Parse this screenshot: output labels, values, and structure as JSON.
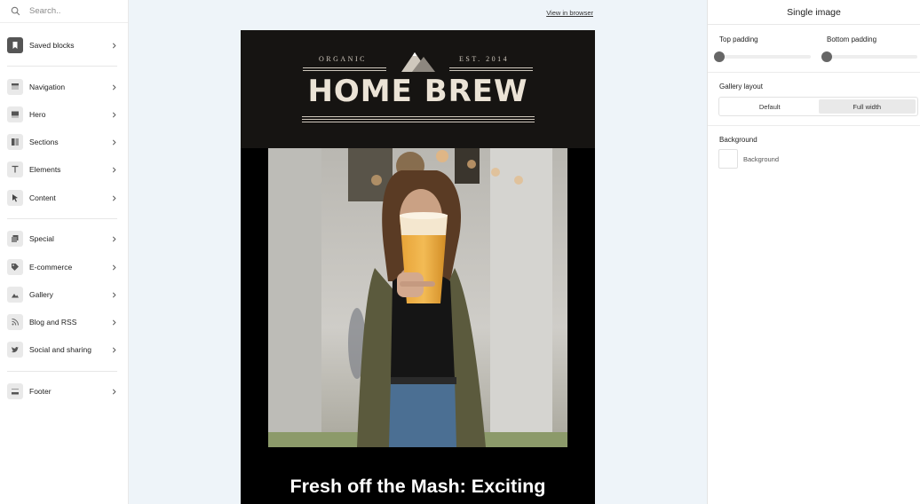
{
  "sidebar": {
    "search_placeholder": "Search..",
    "items": [
      {
        "label": "Saved blocks",
        "icon": "bookmark-icon"
      },
      {
        "label": "Navigation",
        "icon": "navigation-icon"
      },
      {
        "label": "Hero",
        "icon": "hero-icon"
      },
      {
        "label": "Sections",
        "icon": "sections-icon"
      },
      {
        "label": "Elements",
        "icon": "text-icon"
      },
      {
        "label": "Content",
        "icon": "cursor-icon"
      },
      {
        "label": "Special",
        "icon": "special-icon"
      },
      {
        "label": "E-commerce",
        "icon": "tag-icon"
      },
      {
        "label": "Gallery",
        "icon": "image-icon"
      },
      {
        "label": "Blog and RSS",
        "icon": "rss-icon"
      },
      {
        "label": "Social and sharing",
        "icon": "twitter-icon"
      },
      {
        "label": "Footer",
        "icon": "footer-icon"
      }
    ]
  },
  "canvas": {
    "view_in_browser": "View in browser",
    "email": {
      "organic": "ORGANIC",
      "est": "EST. 2014",
      "brand": "HOME BREW",
      "headline": "Fresh off the Mash: Exciting"
    }
  },
  "panel": {
    "title": "Single image",
    "top_padding_label": "Top padding",
    "bottom_padding_label": "Bottom padding",
    "gallery_layout_label": "Gallery layout",
    "layout_options": [
      "Default",
      "Full width"
    ],
    "selected_layout": "Full width",
    "background_label": "Background",
    "background_swatch_label": "Background",
    "background_color": "#ffffff"
  },
  "colors": {
    "canvas_bg": "#eef4f9",
    "header_bg": "#161412",
    "brand_text": "#ebe3d6"
  }
}
